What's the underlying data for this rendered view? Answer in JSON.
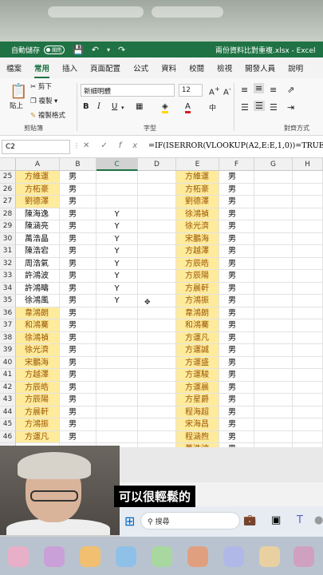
{
  "title_bar": {
    "autosave_label": "自動儲存",
    "autosave_state": "關閉",
    "filename": "兩份資料比對重複.xlsx - Excel"
  },
  "ribbon_tabs": [
    "檔案",
    "常用",
    "插入",
    "頁面配置",
    "公式",
    "資料",
    "校閱",
    "檢視",
    "開發人員",
    "說明"
  ],
  "active_tab": "常用",
  "clipboard": {
    "paste": "貼上",
    "cut": "剪下",
    "copy": "複製",
    "format_painter": "複製格式",
    "group_label": "剪貼簿"
  },
  "font": {
    "name": "新細明體",
    "size": "12",
    "group_label": "字型"
  },
  "alignment": {
    "group_label": "對齊方式"
  },
  "formula_bar": {
    "cell_ref": "C2",
    "formula": "=IF(ISERROR(VLOOKUP(A2,E:E,1,0))=TRUE,\""
  },
  "columns": [
    "A",
    "B",
    "C",
    "D",
    "E",
    "F",
    "G",
    "H"
  ],
  "selected_column": "C",
  "rows": [
    {
      "n": "25",
      "a": "方維運",
      "a_hl": true,
      "b": "男",
      "c": "",
      "e": "方維運",
      "e_hl": true,
      "f": "男"
    },
    {
      "n": "26",
      "a": "方柘豪",
      "a_hl": true,
      "b": "男",
      "c": "",
      "e": "方柘豪",
      "e_hl": true,
      "f": "男"
    },
    {
      "n": "27",
      "a": "劉德澤",
      "a_hl": true,
      "b": "男",
      "c": "",
      "e": "劉德澤",
      "e_hl": true,
      "f": "男"
    },
    {
      "n": "28",
      "a": "陳海逸",
      "a_hl": false,
      "b": "男",
      "c": "Y",
      "e": "徐鴻禎",
      "e_hl": true,
      "f": "男"
    },
    {
      "n": "29",
      "a": "陳涵亮",
      "a_hl": false,
      "b": "男",
      "c": "Y",
      "e": "徐光濟",
      "e_hl": true,
      "f": "男"
    },
    {
      "n": "30",
      "a": "萬浩晶",
      "a_hl": false,
      "b": "男",
      "c": "Y",
      "e": "宋鵬海",
      "e_hl": true,
      "f": "男"
    },
    {
      "n": "31",
      "a": "陳浩宕",
      "a_hl": false,
      "b": "男",
      "c": "Y",
      "e": "方越澤",
      "e_hl": true,
      "f": "男"
    },
    {
      "n": "32",
      "a": "周浩氣",
      "a_hl": false,
      "b": "男",
      "c": "Y",
      "e": "方辰皓",
      "e_hl": true,
      "f": "男"
    },
    {
      "n": "33",
      "a": "許鴻波",
      "a_hl": false,
      "b": "男",
      "c": "Y",
      "e": "方辰陽",
      "e_hl": true,
      "f": "男"
    },
    {
      "n": "34",
      "a": "許鴻疇",
      "a_hl": false,
      "b": "男",
      "c": "Y",
      "e": "方晨軒",
      "e_hl": true,
      "f": "男"
    },
    {
      "n": "35",
      "a": "徐鴻風",
      "a_hl": false,
      "b": "男",
      "c": "Y",
      "e": "方鴻振",
      "e_hl": true,
      "f": "男"
    },
    {
      "n": "36",
      "a": "韋鴻朗",
      "a_hl": true,
      "b": "男",
      "c": "",
      "e": "韋鴻朗",
      "e_hl": true,
      "f": "男"
    },
    {
      "n": "37",
      "a": "和鴻騫",
      "a_hl": true,
      "b": "男",
      "c": "",
      "e": "和鴻騫",
      "e_hl": true,
      "f": "男"
    },
    {
      "n": "38",
      "a": "徐鴻禎",
      "a_hl": true,
      "b": "男",
      "c": "",
      "e": "方運凡",
      "e_hl": true,
      "f": "男"
    },
    {
      "n": "39",
      "a": "徐光濟",
      "a_hl": true,
      "b": "男",
      "c": "",
      "e": "方運誠",
      "e_hl": true,
      "f": "男"
    },
    {
      "n": "40",
      "a": "宋鵬海",
      "a_hl": true,
      "b": "男",
      "c": "",
      "e": "方運盛",
      "e_hl": true,
      "f": "男"
    },
    {
      "n": "41",
      "a": "方越澤",
      "a_hl": true,
      "b": "男",
      "c": "",
      "e": "方運駿",
      "e_hl": true,
      "f": "男"
    },
    {
      "n": "42",
      "a": "方辰皓",
      "a_hl": true,
      "b": "男",
      "c": "",
      "e": "方運晨",
      "e_hl": true,
      "f": "男"
    },
    {
      "n": "43",
      "a": "方辰陽",
      "a_hl": true,
      "b": "男",
      "c": "",
      "e": "方星爵",
      "e_hl": true,
      "f": "男"
    },
    {
      "n": "44",
      "a": "方晨軒",
      "a_hl": true,
      "b": "男",
      "c": "",
      "e": "程海超",
      "e_hl": true,
      "f": "男"
    },
    {
      "n": "45",
      "a": "方鴻振",
      "a_hl": true,
      "b": "男",
      "c": "",
      "e": "宋海昌",
      "e_hl": true,
      "f": "男"
    },
    {
      "n": "46",
      "a": "方運凡",
      "a_hl": true,
      "b": "男",
      "c": "",
      "e": "程涵煦",
      "e_hl": true,
      "f": "男"
    },
    {
      "n": "",
      "a": "",
      "a_hl": false,
      "b": "",
      "c": "",
      "e": "萬浩波",
      "e_hl": true,
      "f": "男"
    }
  ],
  "taskbar": {
    "search_placeholder": "搜尋"
  },
  "subtitle": "可以很輕鬆的",
  "colors": {
    "excel_green": "#1f7244",
    "highlight_fill": "#ffeb9c",
    "highlight_text": "#9c5700"
  }
}
